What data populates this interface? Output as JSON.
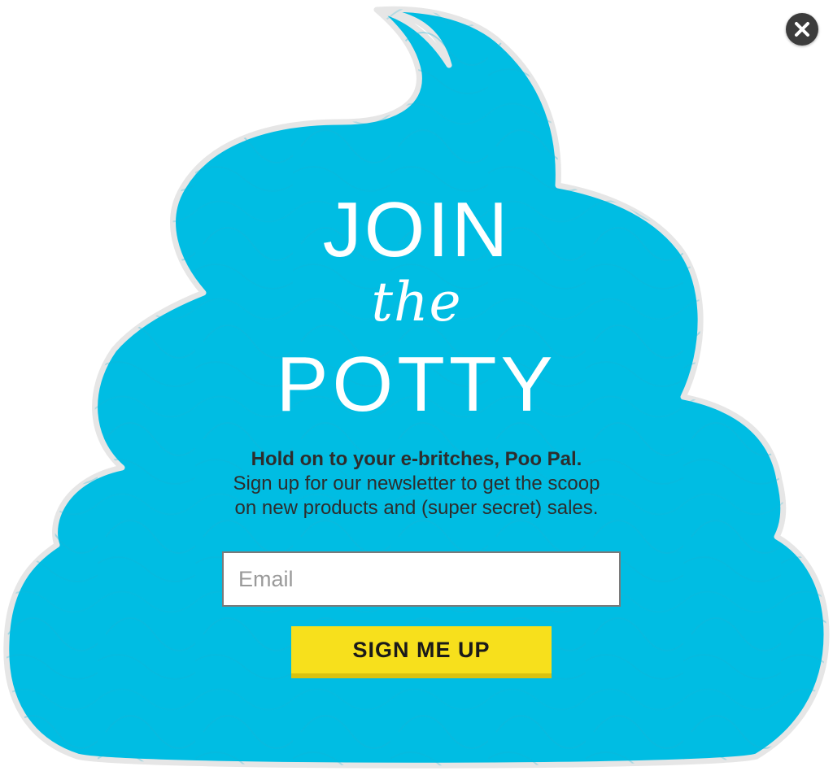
{
  "headline": {
    "line1": "JOIN",
    "line2": "the",
    "line3": "POTTY"
  },
  "subcopy": {
    "lead": "Hold on to your e-britches, Poo Pal.",
    "line2": "Sign up for our newsletter to get the scoop",
    "line3": "on new products and (super secret) sales."
  },
  "form": {
    "email_placeholder": "Email",
    "email_value": "",
    "submit_label": "SIGN ME UP"
  },
  "icons": {
    "close": "close-icon"
  },
  "colors": {
    "shape_fill": "#00bde3",
    "shape_outline": "#e8e8e8",
    "button": "#f7e01c",
    "close_bg": "#3c3c3c",
    "text": "#2d2d2d"
  }
}
